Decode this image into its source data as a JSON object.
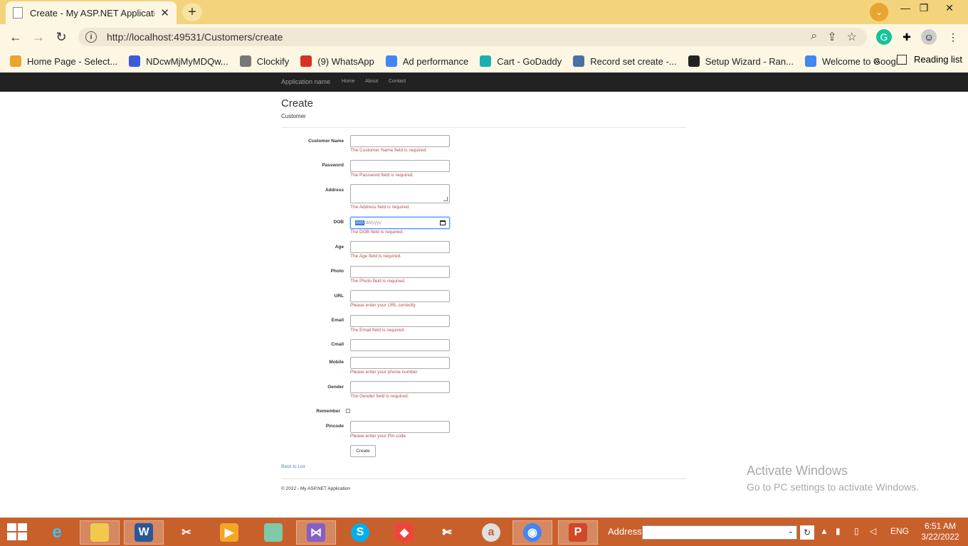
{
  "browser": {
    "tab_title": "Create - My ASP.NET Application",
    "url": "http://localhost:49531/Customers/create",
    "bookmarks": [
      {
        "label": "Home Page - Select...",
        "color": "#e8a530"
      },
      {
        "label": "NDcwMjMyMDQw...",
        "color": "#3b5bdb"
      },
      {
        "label": "Clockify",
        "color": "#777777"
      },
      {
        "label": "(9) WhatsApp",
        "color": "#d93025"
      },
      {
        "label": "Ad performance",
        "color": "#4285f4"
      },
      {
        "label": "Cart - GoDaddy",
        "color": "#1bb1b1"
      },
      {
        "label": "Record set create -...",
        "color": "#4a6fa5"
      },
      {
        "label": "Setup Wizard - Ran...",
        "color": "#222222"
      },
      {
        "label": "Welcome to Googl...",
        "color": "#4285f4"
      }
    ],
    "more_bookmarks": "»",
    "reading_list": "Reading list"
  },
  "site": {
    "brand": "Application name",
    "nav": [
      "Home",
      "About",
      "Contact"
    ]
  },
  "form": {
    "heading": "Create",
    "subheading": "Customer",
    "fields": [
      {
        "label": "Customer Name",
        "error": "The Customer Name field is required."
      },
      {
        "label": "Password",
        "error": "The Password field is required."
      },
      {
        "label": "Address",
        "error": "The Address field is required."
      },
      {
        "label": "DOB",
        "error": "The DOB field is required.",
        "placeholder_mm": "mm",
        "placeholder_rest": "/dd/yyyy"
      },
      {
        "label": "Age",
        "error": "The Age field is required."
      },
      {
        "label": "Photo",
        "error": "The Photo field is required."
      },
      {
        "label": "URL",
        "error": "Please enter your URL correctly"
      },
      {
        "label": "Email",
        "error": "The Email field is required."
      },
      {
        "label": "Cmail",
        "error": ""
      },
      {
        "label": "Mobile",
        "error": "Please enter your phone number"
      },
      {
        "label": "Gender",
        "error": "The Gender field is required."
      },
      {
        "label": "Remember",
        "error": ""
      },
      {
        "label": "Pincode",
        "error": "Please enter your Pin code"
      }
    ],
    "submit_label": "Create",
    "back_link": "Back to List",
    "footer": "© 2022 - My ASP.NET Application"
  },
  "watermark": {
    "line1": "Activate Windows",
    "line2": "Go to PC settings to activate Windows."
  },
  "taskbar": {
    "address_label": "Address",
    "language": "ENG",
    "time": "6:51 AM",
    "date": "3/22/2022"
  }
}
